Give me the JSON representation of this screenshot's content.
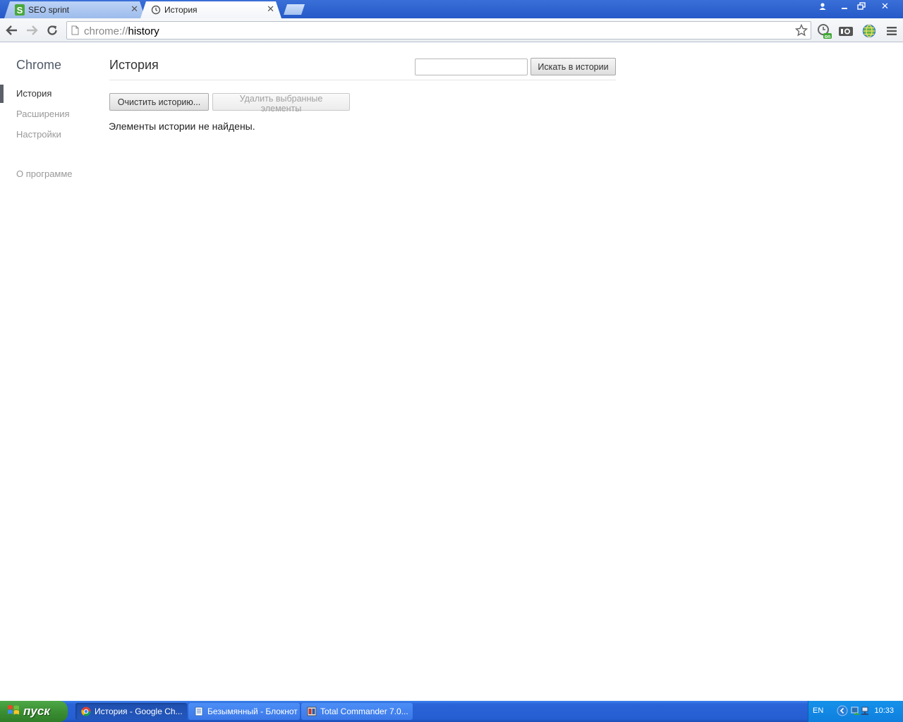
{
  "tabs": [
    {
      "title": "SEO sprint",
      "icon": "seo-sprint-icon",
      "active": false
    },
    {
      "title": "История",
      "icon": "history-icon",
      "active": true
    }
  ],
  "toolbar": {
    "url_scheme": "chrome://",
    "url_path": "history"
  },
  "sidebar": {
    "title": "Chrome",
    "items": [
      {
        "label": "История",
        "selected": true
      },
      {
        "label": "Расширения",
        "selected": false
      },
      {
        "label": "Настройки",
        "selected": false
      }
    ],
    "about": "О программе"
  },
  "main": {
    "title": "История",
    "search_placeholder": "",
    "search_button": "Искать в истории",
    "clear_button": "Очистить историю...",
    "delete_button": "Удалить выбранные элементы",
    "empty_message": "Элементы истории не найдены."
  },
  "taskbar": {
    "start_label": "пуск",
    "tasks": [
      {
        "label": "История - Google Ch...",
        "icon": "chrome-icon",
        "active": true
      },
      {
        "label": "Безымянный - Блокнот",
        "icon": "notepad-icon",
        "active": false
      },
      {
        "label": "Total Commander 7.0...",
        "icon": "total-commander-icon",
        "active": false
      }
    ],
    "language": "EN",
    "clock": "10:33"
  },
  "colors": {
    "title_bar": "#2f63d0",
    "taskbar": "#245ed1",
    "start_button": "#3b8f33",
    "tray": "#0f7fde"
  }
}
